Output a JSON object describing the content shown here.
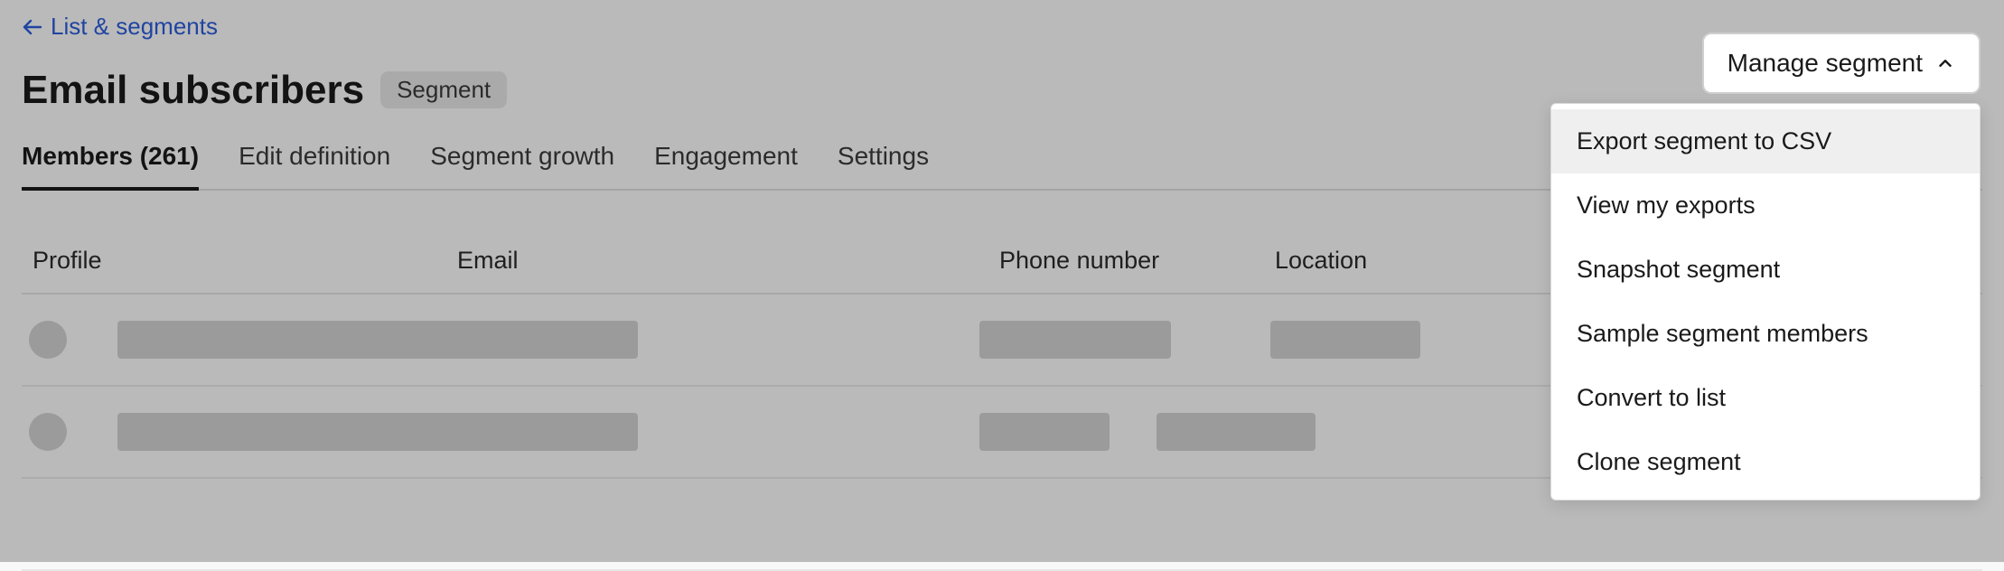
{
  "breadcrumb": {
    "label": "List & segments"
  },
  "header": {
    "title": "Email subscribers",
    "badge": "Segment"
  },
  "tabs": [
    {
      "label": "Members (261)",
      "active": true
    },
    {
      "label": "Edit definition",
      "active": false
    },
    {
      "label": "Segment growth",
      "active": false
    },
    {
      "label": "Engagement",
      "active": false
    },
    {
      "label": "Settings",
      "active": false
    }
  ],
  "table": {
    "columns": [
      "Profile",
      "Email",
      "Phone number",
      "Location"
    ]
  },
  "manage": {
    "button_label": "Manage segment",
    "items": [
      "Export segment to CSV",
      "View my exports",
      "Snapshot segment",
      "Sample segment members",
      "Convert to list",
      "Clone segment"
    ],
    "highlighted_index": 0
  }
}
